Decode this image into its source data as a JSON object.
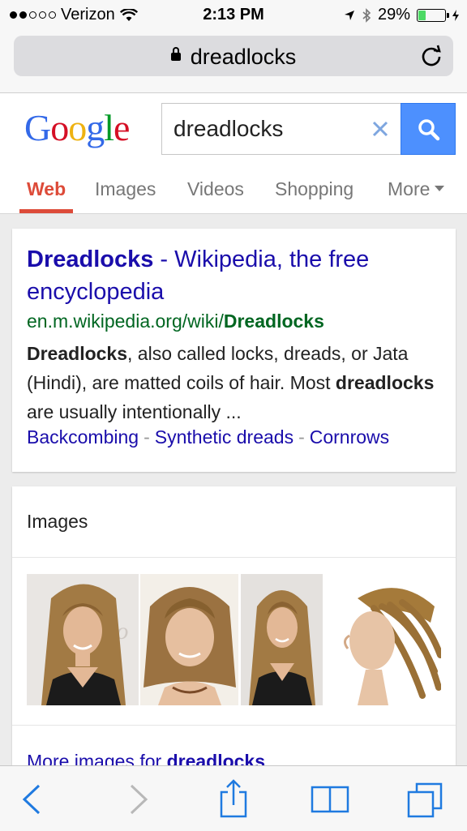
{
  "status_bar": {
    "carrier": "Verizon",
    "time": "2:13 PM",
    "battery": "29%",
    "battery_level": 0.29
  },
  "browser": {
    "url_display": "dreadlocks"
  },
  "google": {
    "logo": [
      "G",
      "o",
      "o",
      "g",
      "l",
      "e"
    ],
    "logo_colors": [
      "#3369e8",
      "#d50f25",
      "#eeb211",
      "#3369e8",
      "#009925",
      "#d50f25"
    ],
    "search_value": "dreadlocks",
    "tabs": [
      "Web",
      "Images",
      "Videos",
      "Shopping",
      "More"
    ]
  },
  "result": {
    "title_bold": "Dreadlocks",
    "title_rest": " - Wikipedia, the free encyclopedia",
    "url_prefix": "en.m.wikipedia.org/wiki/",
    "url_bold": "Dreadlocks",
    "snippet_1_bold": "Dreadlocks",
    "snippet_1": ", also called locks, dreads, or Jata (Hindi), are matted coils of hair. Most ",
    "snippet_2_bold": "dreadlocks",
    "snippet_2": " are usually intentionally ...",
    "links": [
      "Backcombing",
      "Synthetic dreads",
      "Cornrows"
    ],
    "separator": "-"
  },
  "images_section": {
    "heading": "Images",
    "more_prefix": "More images for ",
    "more_bold": "dreadlocks"
  },
  "colors": {
    "accent_red": "#dd4b39",
    "link_blue": "#1a0dab",
    "url_green": "#006621",
    "ios_blue": "#1f7ae0"
  }
}
